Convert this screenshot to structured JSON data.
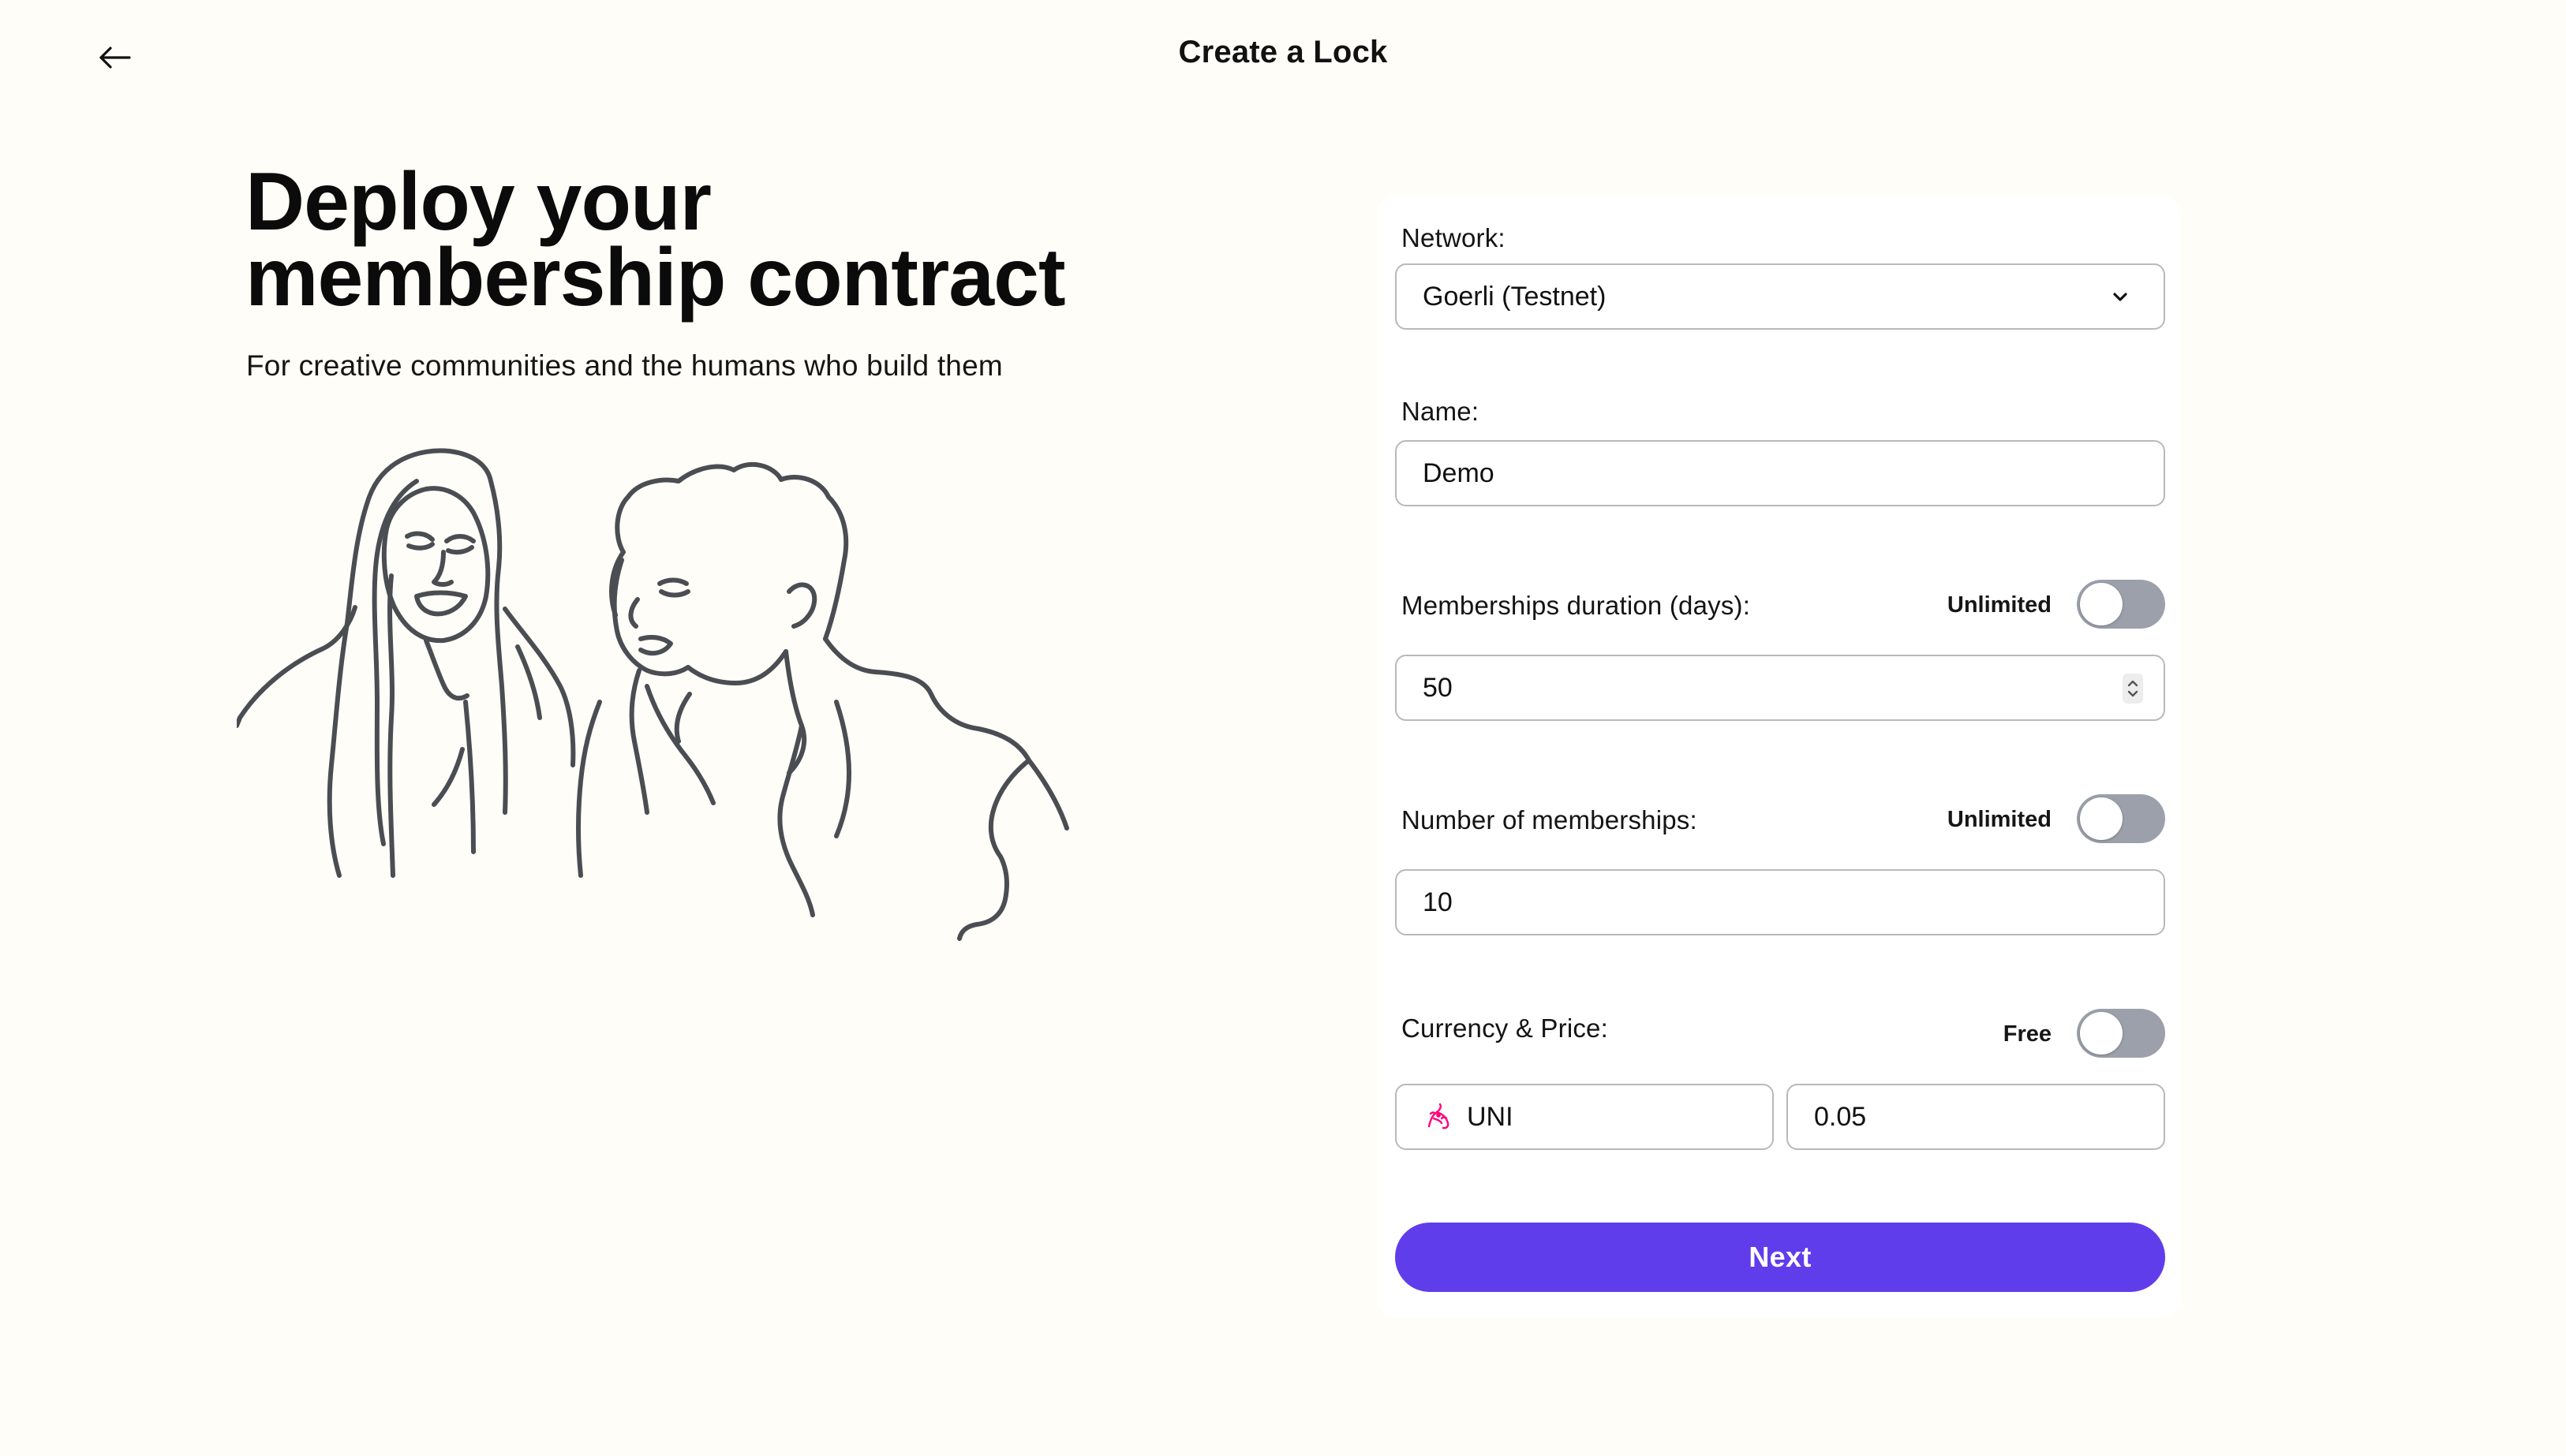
{
  "header": {
    "title": "Create a Lock",
    "back_icon": "arrow-left-icon"
  },
  "hero": {
    "heading_line1": "Deploy your",
    "heading_line2": "membership contract",
    "subtitle": "For creative communities and the humans who build them",
    "illustration_icon": "people-line-drawing-icon"
  },
  "form": {
    "network": {
      "label": "Network:",
      "value": "Goerli (Testnet)",
      "icon": "chevron-down-icon"
    },
    "name": {
      "label": "Name:",
      "value": "Demo"
    },
    "duration": {
      "label": "Memberships duration (days):",
      "toggle_label": "Unlimited",
      "toggle_on": false,
      "value": "50",
      "icon": "number-stepper-icon"
    },
    "quantity": {
      "label": "Number of memberships:",
      "toggle_label": "Unlimited",
      "toggle_on": false,
      "value": "10"
    },
    "price": {
      "label": "Currency & Price:",
      "toggle_label": "Free",
      "toggle_on": false,
      "currency": "UNI",
      "currency_icon": "uniswap-unicorn-icon",
      "amount": "0.05"
    },
    "submit_label": "Next"
  },
  "colors": {
    "background": "#FFFDF8",
    "card": "#FFFFFF",
    "accent": "#603DEB",
    "toggle_off": "#9CA0AA",
    "input_border": "#B9B9B9",
    "illustration_stroke": "#4A4D52",
    "uni_pink": "#FF007A"
  }
}
